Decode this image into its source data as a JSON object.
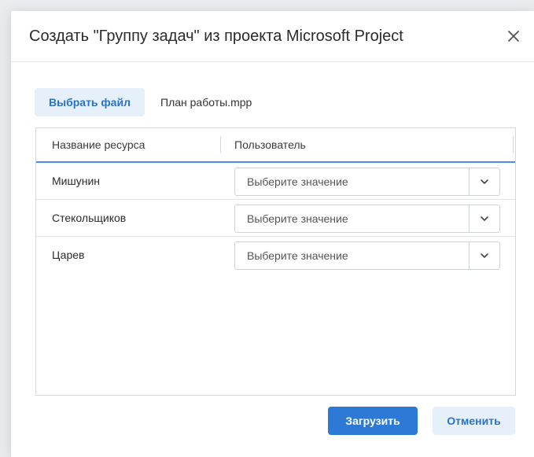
{
  "dialog": {
    "title": "Создать \"Группу задач\" из проекта Microsoft Project",
    "close_icon": "close-icon"
  },
  "file": {
    "choose_label": "Выбрать файл",
    "file_name": "План работы.mpp"
  },
  "grid": {
    "columns": [
      "Название ресурса",
      "Пользователь"
    ],
    "rows": [
      {
        "resource": "Мишунин",
        "user_placeholder": "Выберите значение"
      },
      {
        "resource": "Стекольщиков",
        "user_placeholder": "Выберите значение"
      },
      {
        "resource": "Царев",
        "user_placeholder": "Выберите значение"
      }
    ],
    "chevron_icon": "chevron-down-icon"
  },
  "footer": {
    "submit_label": "Загрузить",
    "cancel_label": "Отменить"
  },
  "colors": {
    "accent": "#2d7ad6",
    "accent_light": "#e6f0fb",
    "header_underline": "#4a8ee0"
  }
}
